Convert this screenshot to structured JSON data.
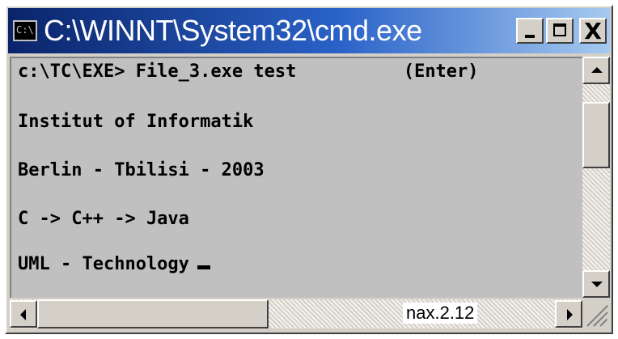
{
  "window": {
    "title": "C:\\WINNT\\System32\\cmd.exe",
    "icon_label": "C:\\",
    "controls": {
      "minimize": "minimize-icon",
      "maximize": "maximize-icon",
      "close_label": "X"
    }
  },
  "console": {
    "lines": [
      "c:\\TC\\EXE> File_3.exe test          (Enter)",
      "Institut of Informatik",
      "Berlin - Tbilisi - 2003",
      "C -> C++ -> Java",
      "UML - Technology"
    ],
    "cursor": "_"
  },
  "caption": "nax.2.12",
  "colors": {
    "console_background": "#c0c0c0",
    "console_text": "#000000",
    "titlebar_start": "#0a246a",
    "titlebar_end": "#a6caf0",
    "window_face": "#d4d0c8"
  }
}
